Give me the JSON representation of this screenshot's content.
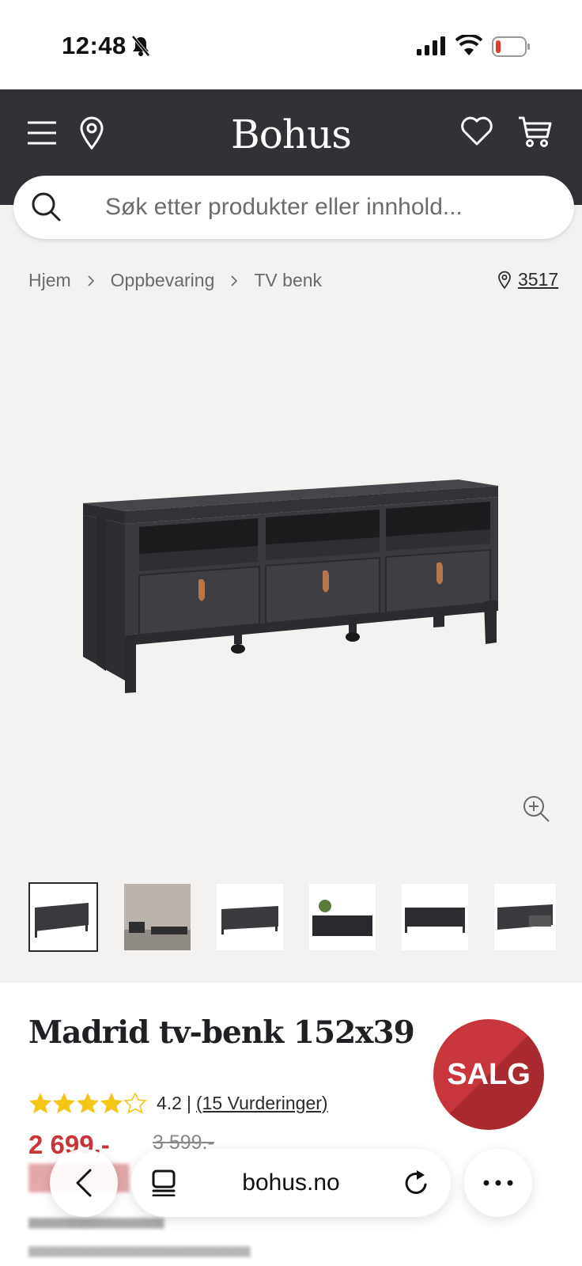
{
  "status_bar": {
    "time": "12:48"
  },
  "header": {
    "logo": "Bohus"
  },
  "search": {
    "placeholder": "Søk etter produkter eller innhold..."
  },
  "breadcrumb": {
    "items": [
      "Hjem",
      "Oppbevaring",
      "TV benk"
    ]
  },
  "store": {
    "number": "3517"
  },
  "gallery": {
    "thumbnail_count": 6,
    "selected_index": 0
  },
  "product": {
    "title": "Madrid tv-benk 152x39",
    "badge": "SALG",
    "rating_value": "4.2",
    "rating_separator": "|",
    "reviews_label": "(15 Vurderinger)",
    "stars_filled": 4,
    "stars_total": 5,
    "price": "2 699,-",
    "old_price": "3 599,-"
  },
  "browser": {
    "url": "bohus.no"
  },
  "colors": {
    "header_bg": "#323236",
    "sale_red": "#c8353a",
    "star_yellow": "#f5c518",
    "page_bg": "#f4f2f0"
  }
}
